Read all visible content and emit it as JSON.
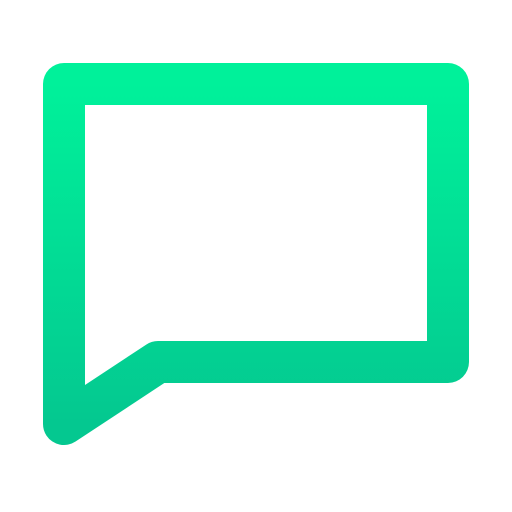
{
  "icon": {
    "semantic_name": "add-comment-icon",
    "gradient_top": "#00F19A",
    "gradient_bottom": "#04C890",
    "background": "#FFFFFF"
  }
}
